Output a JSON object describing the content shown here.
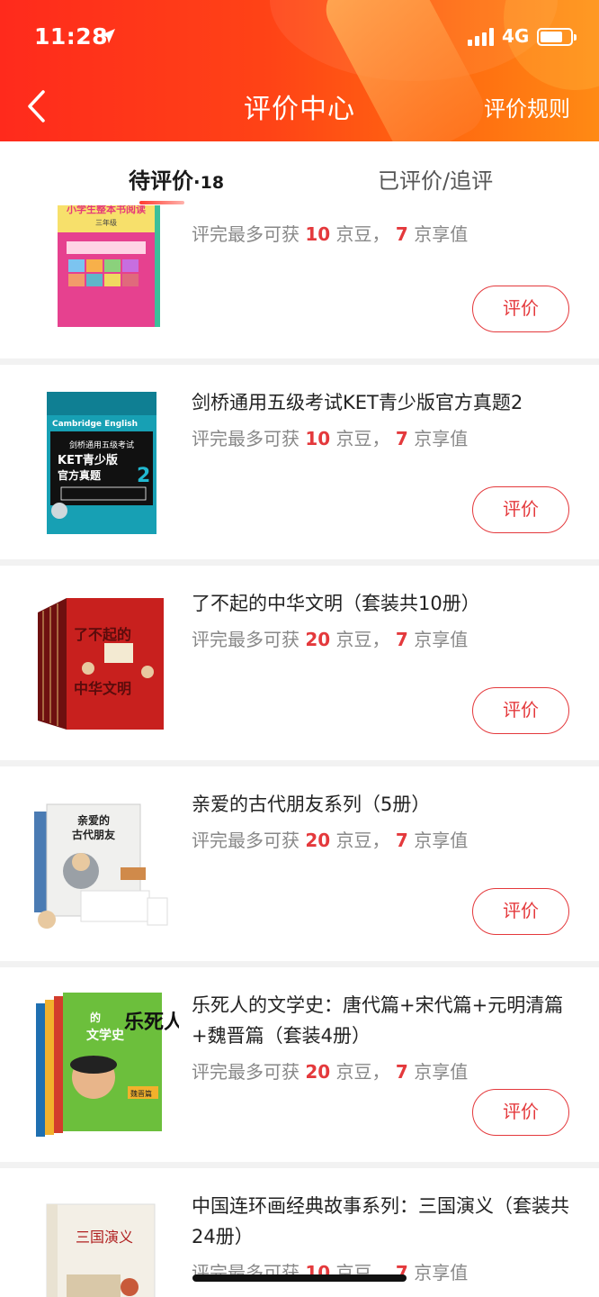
{
  "status_bar": {
    "time": "11:28",
    "network": "4G"
  },
  "header": {
    "title": "评价中心",
    "rules_link": "评价规则"
  },
  "tabs": {
    "pending": {
      "label": "待评价",
      "dot": "·",
      "count": "18"
    },
    "reviewed": {
      "label": "已评价/追评"
    }
  },
  "reward_text": {
    "prefix": "评完最多可获 ",
    "beans_unit": " 京豆，",
    "value_unit": " 京享值"
  },
  "review_button_label": "评价",
  "items": [
    {
      "title": "",
      "beans": "10",
      "value": "7"
    },
    {
      "title": "剑桥通用五级考试KET青少版官方真题2",
      "beans": "10",
      "value": "7"
    },
    {
      "title": "了不起的中华文明（套装共10册）",
      "beans": "20",
      "value": "7"
    },
    {
      "title": "亲爱的古代朋友系列（5册）",
      "beans": "20",
      "value": "7"
    },
    {
      "title": "乐死人的文学史：唐代篇+宋代篇+元明清篇+魏晋篇（套装4册）",
      "beans": "20",
      "value": "7"
    },
    {
      "title": "中国连环画经典故事系列：三国演义（套装共24册）",
      "beans": "10",
      "value": "7"
    }
  ],
  "book_covers": [
    {
      "lines": [
        "小学生整本书阅读",
        "三年级"
      ]
    },
    {
      "lines": [
        "Cambridge English",
        "剑桥通用五级考试",
        "KET青少版",
        "官方真题",
        "2"
      ]
    },
    {
      "lines": [
        "了不起的",
        "中华文明"
      ]
    },
    {
      "lines": [
        "亲爱的",
        "古代朋友"
      ]
    },
    {
      "lines": [
        "乐死人",
        "的",
        "文学史",
        "魏晋篇"
      ]
    },
    {
      "lines": [
        "三国演义"
      ]
    }
  ],
  "colors": {
    "accent": "#e4393c",
    "header_start": "#ff2a1c",
    "header_end": "#ff8a14"
  }
}
